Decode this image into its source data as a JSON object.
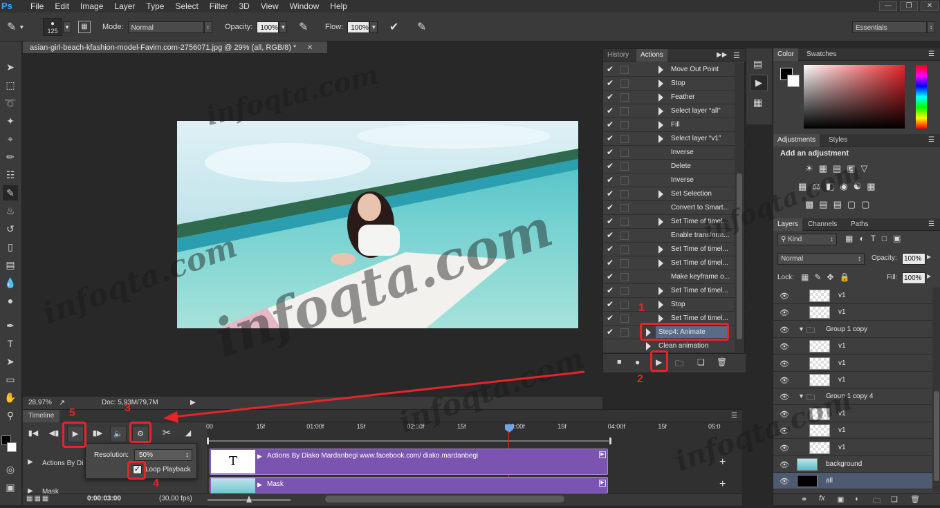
{
  "app": {
    "logo": "Ps"
  },
  "menu": [
    "File",
    "Edit",
    "Image",
    "Layer",
    "Type",
    "Select",
    "Filter",
    "3D",
    "View",
    "Window",
    "Help"
  ],
  "window_controls": [
    "—",
    "❐",
    "✕"
  ],
  "options": {
    "brush_size": "125",
    "mode_label": "Mode:",
    "mode_value": "Normal",
    "opacity_label": "Opacity:",
    "opacity_value": "100%",
    "flow_label": "Flow:",
    "flow_value": "100%",
    "workspace": "Essentials"
  },
  "document": {
    "tab_title": "asian-girl-beach-kfashion-model-Favim.com-2756071.jpg @ 29% (all, RGB/8) *",
    "zoom": "28,97%",
    "doc_size": "Doc: 5,93M/79,7M"
  },
  "actions_panel": {
    "tabs": [
      "History",
      "Actions"
    ],
    "items": [
      {
        "label": "Move Out Point",
        "expand": true
      },
      {
        "label": "Stop",
        "expand": true
      },
      {
        "label": "Feather",
        "expand": true
      },
      {
        "label": "Select layer “all”",
        "expand": true
      },
      {
        "label": "Fill",
        "expand": true
      },
      {
        "label": "Select layer “v1”",
        "expand": true
      },
      {
        "label": "Inverse",
        "expand": false
      },
      {
        "label": "Delete",
        "expand": false
      },
      {
        "label": "Inverse",
        "expand": false
      },
      {
        "label": "Set Selection",
        "expand": true
      },
      {
        "label": "Convert to Smart...",
        "expand": false
      },
      {
        "label": "Set Time of timel...",
        "expand": true
      },
      {
        "label": "Enable transform...",
        "expand": false
      },
      {
        "label": "Set Time of timel...",
        "expand": true
      },
      {
        "label": "Set Time of timel...",
        "expand": true
      },
      {
        "label": "Make keyframe o...",
        "expand": false
      },
      {
        "label": "Set Time of timel...",
        "expand": true
      },
      {
        "label": "Stop",
        "expand": true
      },
      {
        "label": "Set Time of timel...",
        "expand": true
      }
    ],
    "selected_action": "Step4: Animate",
    "next_action": "Clean animation"
  },
  "color_panel": {
    "tabs": [
      "Color",
      "Swatches"
    ]
  },
  "adjustments_panel": {
    "tabs": [
      "Adjustments",
      "Styles"
    ],
    "heading": "Add an adjustment"
  },
  "layers_panel": {
    "tabs": [
      "Layers",
      "Channels",
      "Paths"
    ],
    "kind_label": "Kind",
    "blend_mode": "Normal",
    "opacity_label": "Opacity:",
    "opacity_value": "100%",
    "lock_label": "Lock:",
    "fill_label": "Fill:",
    "fill_value": "100%",
    "layers": [
      {
        "name": "v1",
        "type": "layer",
        "indent": 1
      },
      {
        "name": "v1",
        "type": "layer",
        "indent": 1
      },
      {
        "name": "Group 1 copy",
        "type": "group",
        "indent": 0
      },
      {
        "name": "v1",
        "type": "layer",
        "indent": 1
      },
      {
        "name": "v1",
        "type": "layer",
        "indent": 1
      },
      {
        "name": "v1",
        "type": "layer",
        "indent": 1
      },
      {
        "name": "Group 1 copy 4",
        "type": "group",
        "indent": 0
      },
      {
        "name": "v1",
        "type": "layer",
        "indent": 1
      },
      {
        "name": "v1",
        "type": "layer",
        "indent": 1
      },
      {
        "name": "v1",
        "type": "layer",
        "indent": 1
      },
      {
        "name": "background",
        "type": "image",
        "indent": 0
      },
      {
        "name": "all",
        "type": "mask",
        "indent": 0,
        "selected": true
      }
    ]
  },
  "timeline": {
    "title": "Timeline",
    "ruler": [
      "00",
      "15f",
      "01:00f",
      "15f",
      "02:00f",
      "15f",
      "03:00f",
      "15f",
      "04:00f",
      "15f",
      "05:0"
    ],
    "track1": "Actions By Diako Mardanbegi www.facebook.com/ diako.mardanbegi",
    "track1_left": "Actions By Di",
    "track2": "Mask",
    "track2_left": "Mask",
    "time": "0:00:03:00",
    "fps": "(30,00 fps)",
    "popup": {
      "resolution_label": "Resolution:",
      "resolution_value": "50%",
      "loop_label": "Loop Playback"
    }
  },
  "annotations": [
    "1",
    "2",
    "3",
    "4",
    "5"
  ],
  "watermark": "infoqta.com",
  "colors": {
    "accent_red": "#e8242a",
    "clip_purple": "#7a54b0",
    "panel": "#3e3e3e"
  }
}
